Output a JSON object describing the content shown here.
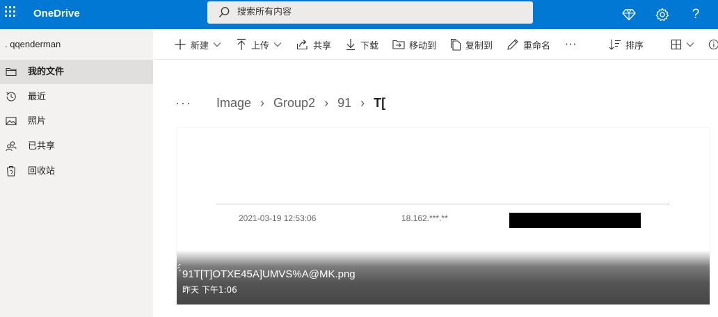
{
  "header": {
    "app_name": "OneDrive",
    "search_placeholder": "搜索所有内容",
    "accent": "#0078d4",
    "help_glyph": "?",
    "icons": [
      "waffle-icon",
      "premium-diamond-icon",
      "settings-gear-icon",
      "help-icon"
    ]
  },
  "sidebar": {
    "user": ". qqenderman",
    "items": [
      {
        "label": "我的文件",
        "icon": "folder-icon",
        "active": true
      },
      {
        "label": "最近",
        "icon": "recent-clock-icon",
        "active": false
      },
      {
        "label": "照片",
        "icon": "photo-icon",
        "active": false
      },
      {
        "label": "已共享",
        "icon": "shared-people-icon",
        "active": false
      },
      {
        "label": "回收站",
        "icon": "recycle-bin-icon",
        "active": false
      }
    ]
  },
  "commands": {
    "new": "新建",
    "upload": "上传",
    "share": "共享",
    "download": "下载",
    "move": "移动到",
    "copy": "复制到",
    "rename": "重命名",
    "more": "···",
    "sort": "排序"
  },
  "breadcrumb": {
    "overflow": "···",
    "items": [
      "Image",
      "Group2",
      "91"
    ],
    "current": "T[",
    "separator": "›"
  },
  "file_tile": {
    "name": "91T[T]OTXE45A]UMVS%A@MK.png",
    "modified": "昨天 下午1:06",
    "preview": {
      "datetime": "2021-03-19 12:53:06",
      "ip": "18.162.***.**"
    }
  }
}
